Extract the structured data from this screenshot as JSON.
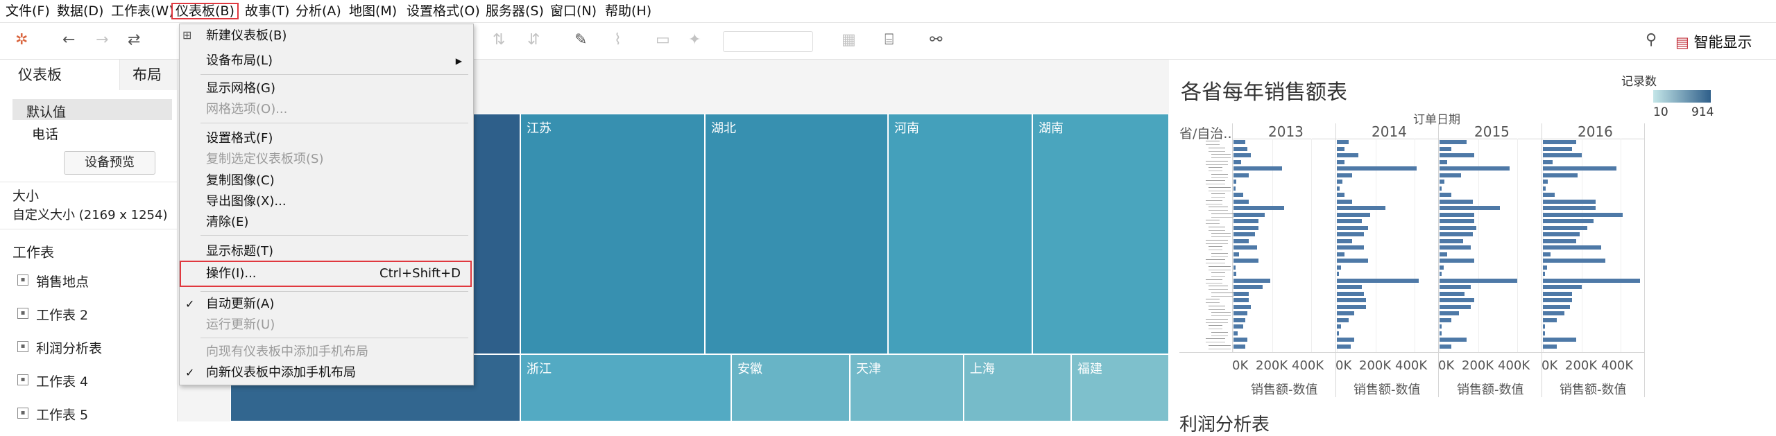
{
  "menubar": [
    "文件(F)",
    "数据(D)",
    "工作表(W)",
    "仪表板(B)",
    "故事(T)",
    "分析(A)",
    "地图(M)",
    "设置格式(O)",
    "服务器(S)",
    "窗口(N)",
    "帮助(H)"
  ],
  "toolbar": {
    "smart_show": "智能显示"
  },
  "dropdown": {
    "items": [
      {
        "label": "新建仪表板(B)",
        "enabled": true
      },
      {
        "label": "设备布局(L)",
        "enabled": true,
        "submenu": true
      },
      {
        "label": "显示网格(G)",
        "enabled": true
      },
      {
        "label": "网格选项(O)...",
        "enabled": false
      },
      {
        "label": "设置格式(F)",
        "enabled": true
      },
      {
        "label": "复制选定仪表板项(S)",
        "enabled": false
      },
      {
        "label": "复制图像(C)",
        "enabled": true
      },
      {
        "label": "导出图像(X)...",
        "enabled": true
      },
      {
        "label": "清除(E)",
        "enabled": true
      },
      {
        "label": "显示标题(T)",
        "enabled": true
      },
      {
        "label": "操作(I)...",
        "enabled": true,
        "shortcut": "Ctrl+Shift+D",
        "highlighted": true
      },
      {
        "label": "自动更新(A)",
        "enabled": true,
        "checked": true
      },
      {
        "label": "运行更新(U)",
        "enabled": false
      },
      {
        "label": "向现有仪表板中添加手机布局",
        "enabled": false
      },
      {
        "label": "向新仪表板中添加手机布局",
        "enabled": true,
        "checked": true
      }
    ]
  },
  "left_panel": {
    "tabs": [
      "仪表板",
      "布局"
    ],
    "device": {
      "default": "默认值",
      "phone": "电话"
    },
    "preview_button": "设备预览",
    "size_title": "大小",
    "size_value": "自定义大小 (2169 x 1254)",
    "sheets_title": "工作表",
    "sheets": [
      "销售地点",
      "工作表 2",
      "利润分析表",
      "工作表 4",
      "工作表 5"
    ]
  },
  "treemap": {
    "tiles": [
      {
        "label": "江苏",
        "color": "#3790b0"
      },
      {
        "label": "湖北",
        "color": "#3790b0"
      },
      {
        "label": "河南",
        "color": "#44a0bb"
      },
      {
        "label": "湖南",
        "color": "#4aa5be"
      },
      {
        "label": "浙江",
        "color": "#53aac3"
      },
      {
        "label": "安徽",
        "color": "#68b4c6"
      },
      {
        "label": "天津",
        "color": "#72b9c9"
      },
      {
        "label": "上海",
        "color": "#76bbc9"
      },
      {
        "label": "福建",
        "color": "#7ec0cc"
      }
    ]
  },
  "chart_panel": {
    "title": "各省每年销售额表",
    "column_header": "订单日期",
    "row_header": "省/自治..",
    "legend": {
      "title": "记录数",
      "min": "10",
      "max": "914",
      "colors": [
        "#c4e6e8",
        "#2f5f8a"
      ]
    },
    "years": [
      "2013",
      "2014",
      "2015",
      "2016"
    ],
    "axis_ticks": [
      "0K",
      "200K",
      "400K"
    ],
    "axis_label": "销售额-数值",
    "next_title": "利润分析表"
  },
  "chart_data": {
    "type": "bar",
    "x_range": [
      0,
      500000
    ],
    "series": [
      {
        "name": "2013",
        "values": [
          60000,
          70000,
          90000,
          40000,
          250000,
          80000,
          15000,
          10000,
          50000,
          80000,
          260000,
          160000,
          130000,
          130000,
          110000,
          80000,
          120000,
          30000,
          130000,
          10000,
          15000,
          190000,
          150000,
          80000,
          80000,
          90000,
          70000,
          60000,
          50000,
          20000,
          70000,
          60000
        ]
      },
      {
        "name": "2014",
        "values": [
          60000,
          40000,
          110000,
          40000,
          410000,
          80000,
          30000,
          15000,
          40000,
          80000,
          250000,
          170000,
          130000,
          160000,
          140000,
          80000,
          140000,
          40000,
          160000,
          20000,
          10000,
          420000,
          130000,
          140000,
          150000,
          150000,
          90000,
          60000,
          20000,
          10000,
          90000,
          70000
        ]
      },
      {
        "name": "2015",
        "values": [
          140000,
          60000,
          180000,
          40000,
          360000,
          110000,
          25000,
          10000,
          60000,
          170000,
          310000,
          180000,
          180000,
          190000,
          170000,
          120000,
          160000,
          40000,
          180000,
          20000,
          10000,
          400000,
          160000,
          130000,
          180000,
          160000,
          100000,
          60000,
          10000,
          10000,
          140000,
          60000
        ]
      },
      {
        "name": "2016",
        "values": [
          170000,
          150000,
          200000,
          50000,
          380000,
          180000,
          25000,
          15000,
          60000,
          270000,
          270000,
          410000,
          260000,
          230000,
          190000,
          170000,
          300000,
          40000,
          320000,
          20000,
          10000,
          500000,
          200000,
          150000,
          150000,
          140000,
          110000,
          70000,
          10000,
          10000,
          170000,
          70000
        ]
      }
    ]
  }
}
